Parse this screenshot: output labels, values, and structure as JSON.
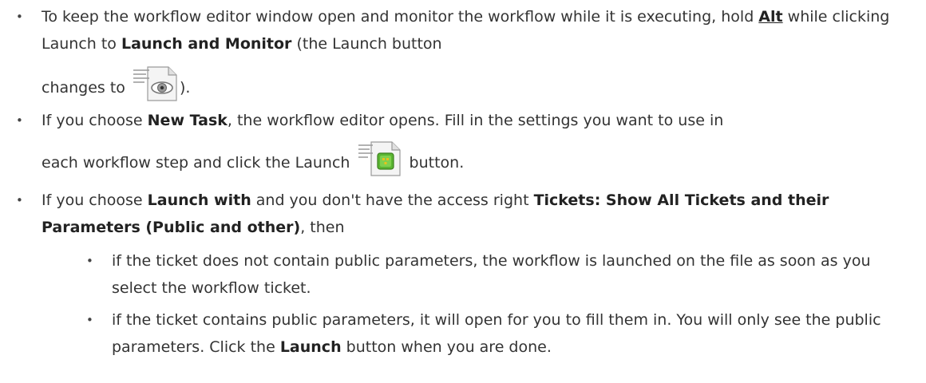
{
  "items": [
    {
      "t1": "To keep the workflow editor window open and monitor the workflow while it is executing, hold ",
      "key": "Alt",
      "t2": " while clicking Launch to ",
      "b1": "Launch and Monitor",
      "t3": " (the Launch button",
      "t4": "changes to ",
      "icon": "launch-monitor-eye-icon",
      "t5": ")."
    },
    {
      "t1": "If you choose ",
      "b1": "New Task",
      "t2": ", the workflow editor opens. Fill in the settings you want to use in",
      "t3": "each workflow step and click the Launch ",
      "icon": "launch-green-icon",
      "t4": " button."
    },
    {
      "t1": "If you choose ",
      "b1": "Launch with",
      "t2": " and you don't have the access right ",
      "b2": "Tickets: Show All Tickets and their Parameters (Public and other)",
      "t3": ", then",
      "sub": [
        {
          "text": "if the ticket does not contain public parameters, the workflow is launched on the file as soon as you select the workflow ticket."
        },
        {
          "t1": "if the ticket contains public parameters, it will open for you to fill them in. You will only see the public parameters. Click the ",
          "b1": "Launch",
          "t2": " button when you are done."
        }
      ]
    }
  ],
  "bullet_char": "•"
}
